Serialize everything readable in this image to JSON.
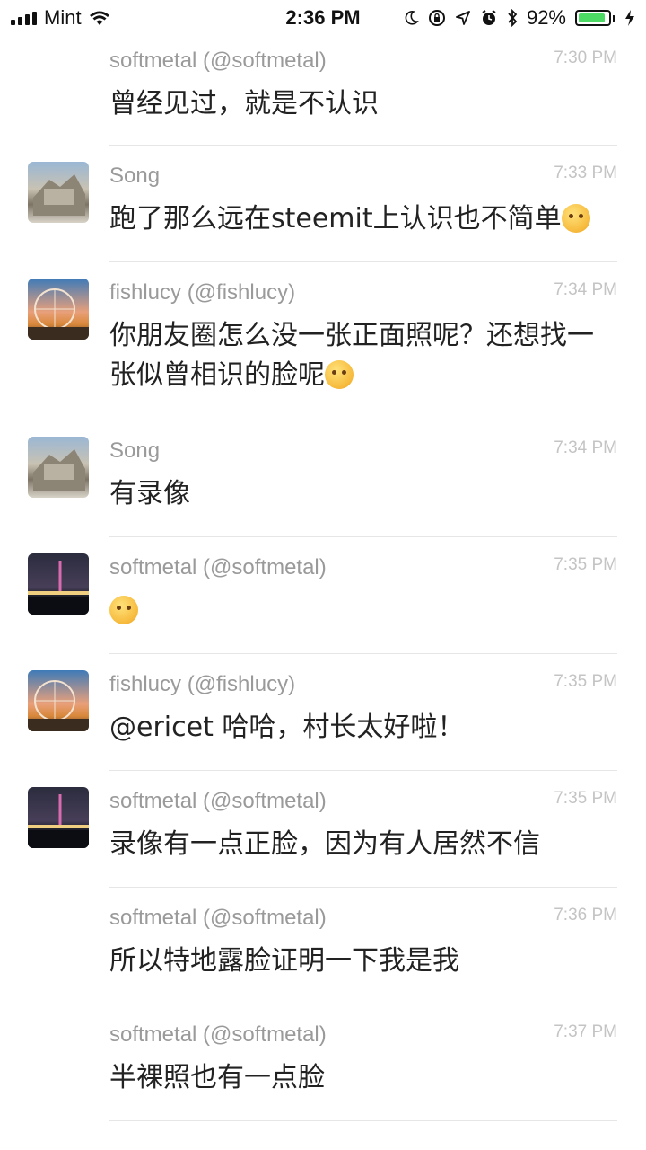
{
  "status_bar": {
    "carrier": "Mint",
    "time": "2:36 PM",
    "battery_percent": "92%",
    "battery_level": 0.92,
    "battery_color": "#4cd964",
    "icons": [
      "signal-icon",
      "wifi-icon",
      "moon-icon",
      "rotation-lock-icon",
      "location-icon",
      "alarm-icon",
      "bluetooth-icon",
      "battery-icon",
      "charging-icon"
    ]
  },
  "messages": [
    {
      "sender": "softmetal (@softmetal)",
      "time": "7:30 PM",
      "text": "曾经见过，就是不认识",
      "avatar": "",
      "emoji": ""
    },
    {
      "sender": "Song",
      "time": "7:33 PM",
      "text": "跑了那么远在steemit上认识也不简单",
      "avatar": "song",
      "emoji": "thinking-face-emoji"
    },
    {
      "sender": "fishlucy (@fishlucy)",
      "time": "7:34 PM",
      "text": "你朋友圈怎么没一张正面照呢？还想找一张似曾相识的脸呢",
      "avatar": "fish",
      "emoji": "flushed-face-emoji"
    },
    {
      "sender": "Song",
      "time": "7:34 PM",
      "text": "有录像",
      "avatar": "song",
      "emoji": ""
    },
    {
      "sender": "softmetal (@softmetal)",
      "time": "7:35 PM",
      "text": "",
      "avatar": "soft",
      "emoji": "pleading-face-emoji"
    },
    {
      "sender": "fishlucy (@fishlucy)",
      "time": "7:35 PM",
      "text": "@ericet 哈哈，村长太好啦！",
      "avatar": "fish",
      "emoji": ""
    },
    {
      "sender": "softmetal (@softmetal)",
      "time": "7:35 PM",
      "text": "录像有一点正脸，因为有人居然不信",
      "avatar": "soft",
      "emoji": ""
    },
    {
      "sender": "softmetal (@softmetal)",
      "time": "7:36 PM",
      "text": "所以特地露脸证明一下我是我",
      "avatar": "",
      "emoji": ""
    },
    {
      "sender": "softmetal (@softmetal)",
      "time": "7:37 PM",
      "text": "半裸照也有一点脸",
      "avatar": "",
      "emoji": ""
    }
  ]
}
